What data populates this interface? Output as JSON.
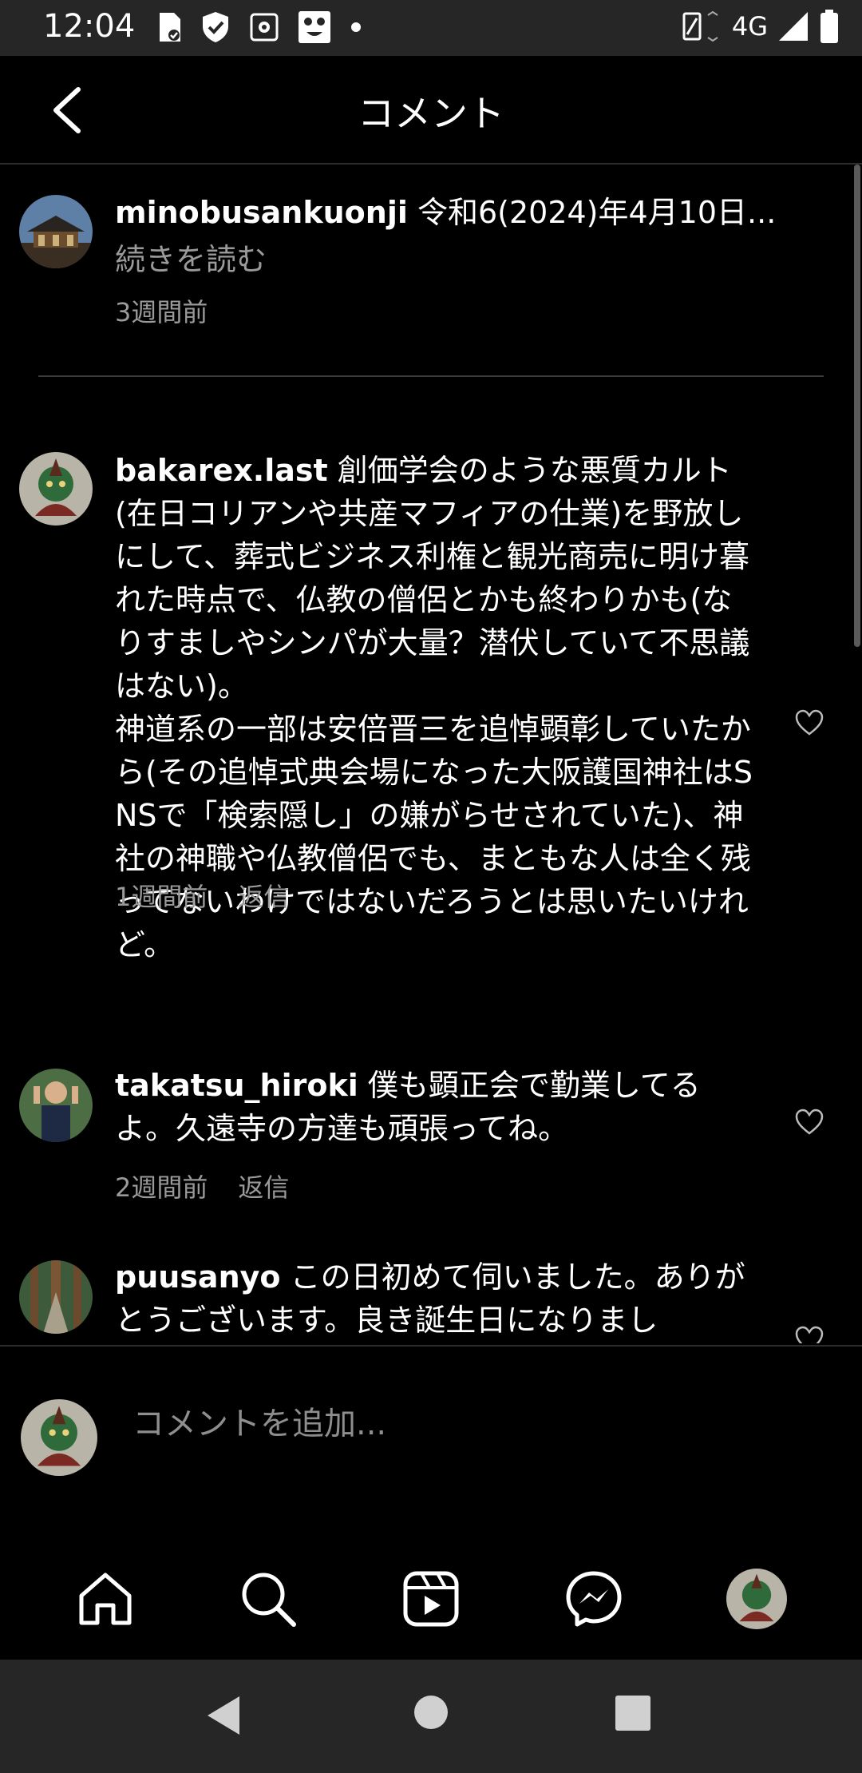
{
  "status_bar": {
    "time": "12:04",
    "network": "4G",
    "icons": [
      "sim-card-icon",
      "shield-check-icon",
      "settings-square-icon",
      "mask-icon",
      "dot-icon",
      "vibrate-icon",
      "signal-icon",
      "battery-icon"
    ]
  },
  "header": {
    "title": "コメント",
    "back_icon": "chevron-left-icon"
  },
  "caption": {
    "username": "minobusankuonji",
    "text": " 令和6(2024)年4月10日...",
    "more_label": "続きを読む",
    "time": "3週間前"
  },
  "comments": [
    {
      "username": "bakarex.last",
      "text": " 創価学会のような悪質カルト(在日コリアンや共産マフィアの仕業)を野放しにして、葬式ビジネス利権と観光商売に明け暮れた時点で、仏教の僧侶とかも終わりかも(なりすましやシンパが大量？潜伏していて不思議はない)。\n神道系の一部は安倍晋三を追悼顕彰していたから(その追悼式典会場になった大阪護国神社はSNSで「検索隠し」の嫌がらせされていた)、神社の神職や仏教僧侶でも、まともな人は全く残ってないわけではないだろうとは思いたいけれど。",
      "time": "1週間前",
      "reply_label": "返信"
    },
    {
      "username": "takatsu_hiroki",
      "text": " 僕も顕正会で勤業してるよ。久遠寺の方達も頑張ってね。",
      "time": "2週間前",
      "reply_label": "返信"
    },
    {
      "username": "puusanyo",
      "text": " この日初めて伺いました。ありがとうございます。良き誕生日になりまし",
      "time": "",
      "reply_label": ""
    }
  ],
  "compose": {
    "placeholder": "コメントを追加..."
  },
  "bottom_nav": {
    "items": [
      "home-icon",
      "search-icon",
      "reels-icon",
      "messenger-icon",
      "profile-avatar"
    ]
  },
  "system_nav": {
    "items": [
      "back-triangle-icon",
      "home-circle-icon",
      "recents-square-icon"
    ]
  },
  "colors": {
    "background": "#000000",
    "system_bar": "#262626",
    "secondary_text": "#9a9a9a",
    "divider": "#3a3a3a"
  }
}
